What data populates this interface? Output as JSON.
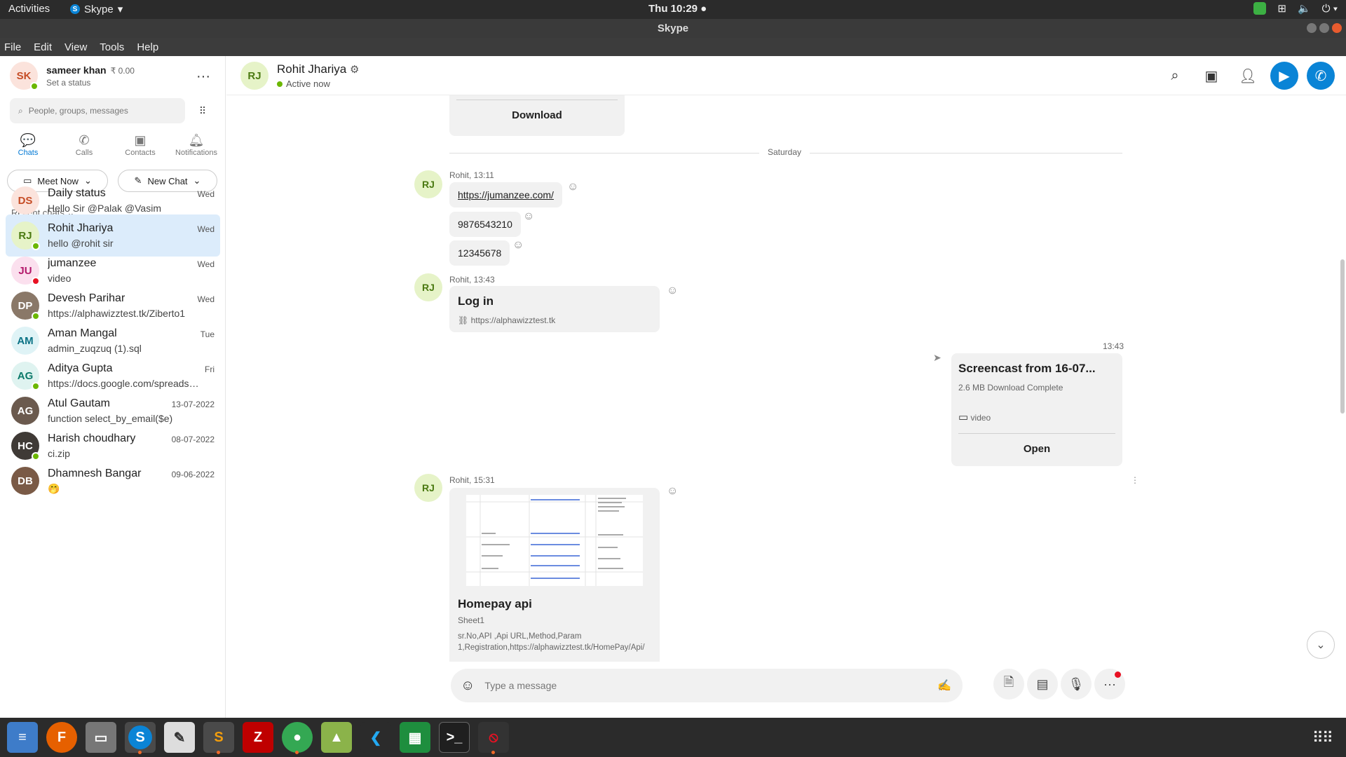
{
  "topbar": {
    "activities": "Activities",
    "app_name": "Skype",
    "clock": "Thu 10:29 ●"
  },
  "window": {
    "title": "Skype"
  },
  "menu": [
    "File",
    "Edit",
    "View",
    "Tools",
    "Help"
  ],
  "profile": {
    "initials": "SK",
    "name": "sameer khan",
    "credit": "₹ 0.00",
    "status": "Set a status"
  },
  "search": {
    "placeholder": "People, groups, messages"
  },
  "nav_tabs": [
    {
      "label": "Chats",
      "icon": "chat-icon"
    },
    {
      "label": "Calls",
      "icon": "phone-icon"
    },
    {
      "label": "Contacts",
      "icon": "contacts-icon"
    },
    {
      "label": "Notifications",
      "icon": "bell-icon"
    }
  ],
  "actions": {
    "meet_now": "Meet Now",
    "new_chat": "New Chat"
  },
  "recent_label": "Recent chats",
  "chats": [
    {
      "initials": "DS",
      "name": "Daily status",
      "preview": "Hello Sir @Palak @Vasim",
      "date": "Wed",
      "color": "#fbe3dc",
      "fg": "#c64d26"
    },
    {
      "initials": "RJ",
      "name": "Rohit Jhariya",
      "preview": "hello @rohit sir",
      "date": "Wed",
      "color": "#e6f3c8",
      "fg": "#4b7a12"
    },
    {
      "initials": "JU",
      "name": "jumanzee",
      "preview": "video",
      "date": "Wed",
      "color": "#fbe0ee",
      "fg": "#b3196b"
    },
    {
      "initials": "DP",
      "name": "Devesh Parihar",
      "preview": "https://alphawizztest.tk/Ziberto1",
      "date": "Wed",
      "color": "#8a7868",
      "fg": "#fff"
    },
    {
      "initials": "AM",
      "name": "Aman Mangal",
      "preview": "admin_zuqzuq (1).sql",
      "date": "Tue",
      "color": "#dff3f6",
      "fg": "#0b7285"
    },
    {
      "initials": "AG",
      "name": "Aditya Gupta",
      "preview": "https://docs.google.com/spreadsh...",
      "date": "Fri",
      "color": "#dff3f0",
      "fg": "#0c7a6a"
    },
    {
      "initials": "AG",
      "name": "Atul Gautam",
      "preview": "function select_by_email($e)",
      "date": "13-07-2022",
      "color": "#6b5a4e",
      "fg": "#fff"
    },
    {
      "initials": "HC",
      "name": "Harish choudhary",
      "preview": "ci.zip",
      "date": "08-07-2022",
      "color": "#3f3a36",
      "fg": "#fff"
    },
    {
      "initials": "DB",
      "name": "Dhamnesh Bangar",
      "preview": "🤭",
      "date": "09-06-2022",
      "color": "#7a5a46",
      "fg": "#fff"
    }
  ],
  "conversation": {
    "contact_initials": "RJ",
    "contact_name": "Rohit Jhariya",
    "presence": "Active now",
    "download_label": "Download",
    "date_separator": "Saturday",
    "msg1_meta": "Rohit, 13:11",
    "msg1_link": "https://jumanzee.com/",
    "msg1_phone": "9876543210",
    "msg1_code": "12345678",
    "msg2_meta": "Rohit, 13:43",
    "msg2_title": "Log in",
    "msg2_url": "https://alphawizztest.tk",
    "sent_time": "13:43",
    "sent_title": "Screencast from 16-07...",
    "sent_info": "2.6 MB Download Complete",
    "sent_type": "video",
    "sent_open": "Open",
    "msg3_meta": "Rohit, 15:31",
    "msg3_title": "Homepay api",
    "msg3_sheet": "Sheet1",
    "msg3_line1": "sr.No,API ,Api  URL,Method,Param",
    "msg3_line2": "1,Registration,https://alphawizztest.tk/HomePay/Api/"
  },
  "composer": {
    "placeholder": "Type a message"
  },
  "taskbar": [
    "files-icon",
    "firefox-icon",
    "archive-icon",
    "skype-icon",
    "text-editor-icon",
    "sublime-icon",
    "filezilla-icon",
    "chrome-icon",
    "image-viewer-icon",
    "vscode-icon",
    "spreadsheet-icon",
    "terminal-icon",
    "recorder-icon"
  ],
  "colors": {
    "accent": "#0a84d6",
    "selected_chat": "#dcecfb",
    "online": "#6bb700"
  }
}
